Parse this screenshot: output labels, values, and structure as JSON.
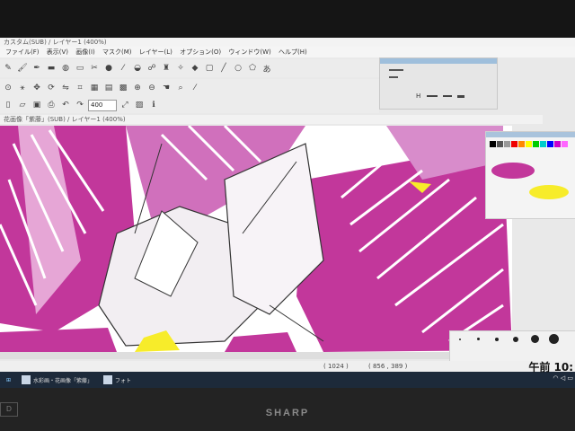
{
  "window": {
    "title": "カスタム(SUB) / レイヤー1   (400%)"
  },
  "menu": [
    "ファイル(F)",
    "表示(V)",
    "画像(I)",
    "マスク(M)",
    "レイヤー(L)",
    "オプション(O)",
    "ウィンドウ(W)",
    "ヘルプ(H)"
  ],
  "document": {
    "title": "花画像「紫藤」(SUB) / レイヤー1   (400%)"
  },
  "zoom_field": "400",
  "float_panel": {
    "label": "H"
  },
  "status": {
    "coords": "( 1024 )",
    "size": "( 856 , 389 )"
  },
  "taskbar": {
    "items": [
      "水彩画・花画像「紫藤」",
      "フォト"
    ],
    "clock": "午前 10:"
  },
  "brand": "SHARP",
  "bezel_label": "D",
  "colors": {
    "magenta": "#c2379b",
    "magenta_light": "#e6a6d6",
    "yellow": "#f7ec2a",
    "canvas_white": "#ffffff"
  }
}
